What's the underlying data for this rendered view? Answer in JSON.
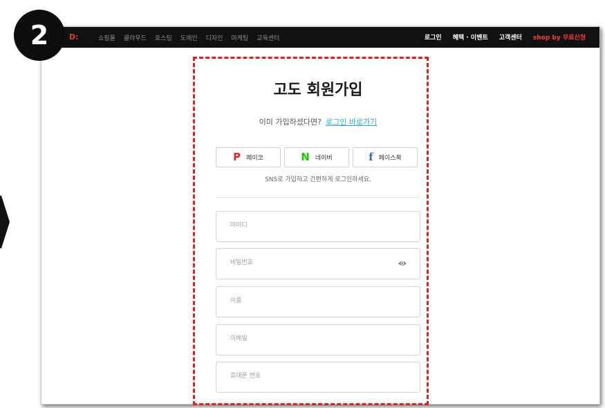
{
  "step_badge": "2",
  "logo_fragment": "D:",
  "nav": {
    "left": [
      "쇼핑몰",
      "클라우드",
      "호스팅",
      "도메인",
      "디자인",
      "마케팅",
      "교육센터"
    ],
    "right": {
      "login": "로그인",
      "events": "혜택 · 이벤트",
      "support": "고객센터",
      "promo": "shop by 무료신청"
    }
  },
  "signup": {
    "title": "고도 회원가입",
    "already_text": "이미 가입하셨다면?",
    "login_link": "로그인 바로가기",
    "sns_buttons": [
      {
        "icon": "P",
        "label": "페이코"
      },
      {
        "icon": "N",
        "label": "네이버"
      },
      {
        "icon": "f",
        "label": "페이스북"
      }
    ],
    "sns_note": "SNS로 가입하고 간편하게 로그인하세요.",
    "fields": {
      "id": {
        "placeholder": "아이디",
        "value": ""
      },
      "password": {
        "placeholder": "비밀번호",
        "value": ""
      },
      "name": {
        "placeholder": "이름",
        "value": ""
      },
      "email": {
        "placeholder": "이메일",
        "value": ""
      },
      "phone": {
        "placeholder": "휴대폰 번호",
        "value": ""
      }
    }
  },
  "colors": {
    "highlight": "#e01f1f",
    "link": "#2aa7d6",
    "payco": "#e8242e",
    "naver": "#1ec800",
    "facebook": "#3b67b8",
    "promo": "#ff3b3b"
  }
}
